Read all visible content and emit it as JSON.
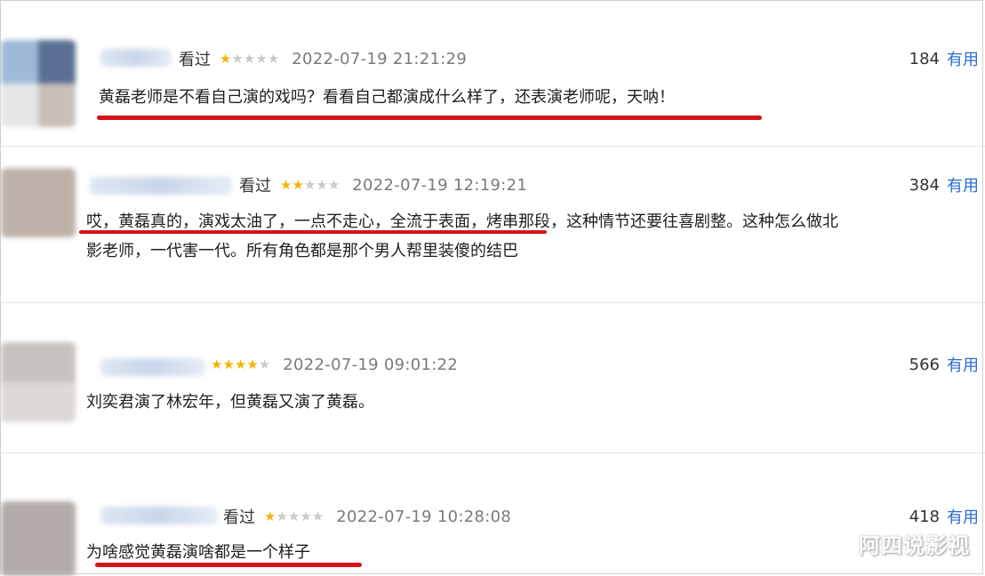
{
  "reviews": [
    {
      "status": "看过",
      "stars": 1,
      "date": "2022-07-19 21:21:29",
      "useful_count": "184",
      "useful_label": "有用",
      "lines": [
        "黄磊老师是不看自己演的戏吗？看看自己都演成什么样了，还表演老师呢，天呐！"
      ]
    },
    {
      "status": "看过",
      "stars": 2,
      "date": "2022-07-19 12:19:21",
      "useful_count": "384",
      "useful_label": "有用",
      "lines": [
        "哎，黄磊真的，演戏太油了，一点不走心，全流于表面，烤串那段，这种情节还要往喜剧整。这种怎么做北",
        "影老师，一代害一代。所有角色都是那个男人帮里装傻的结巴"
      ]
    },
    {
      "status": "",
      "stars": 4,
      "date": "2022-07-19 09:01:22",
      "useful_count": "566",
      "useful_label": "有用",
      "lines": [
        "刘奕君演了林宏年，但黄磊又演了黄磊。"
      ]
    },
    {
      "status": "看过",
      "stars": 1,
      "date": "2022-07-19 10:28:08",
      "useful_count": "418",
      "useful_label": "有用",
      "lines": [
        "为啥感觉黄磊演啥都是一个样子"
      ]
    }
  ],
  "watermark": "阿四说影视",
  "colors": {
    "accent": "#2a6bd1",
    "star": "#f4b400",
    "underline": "#d4141a"
  }
}
